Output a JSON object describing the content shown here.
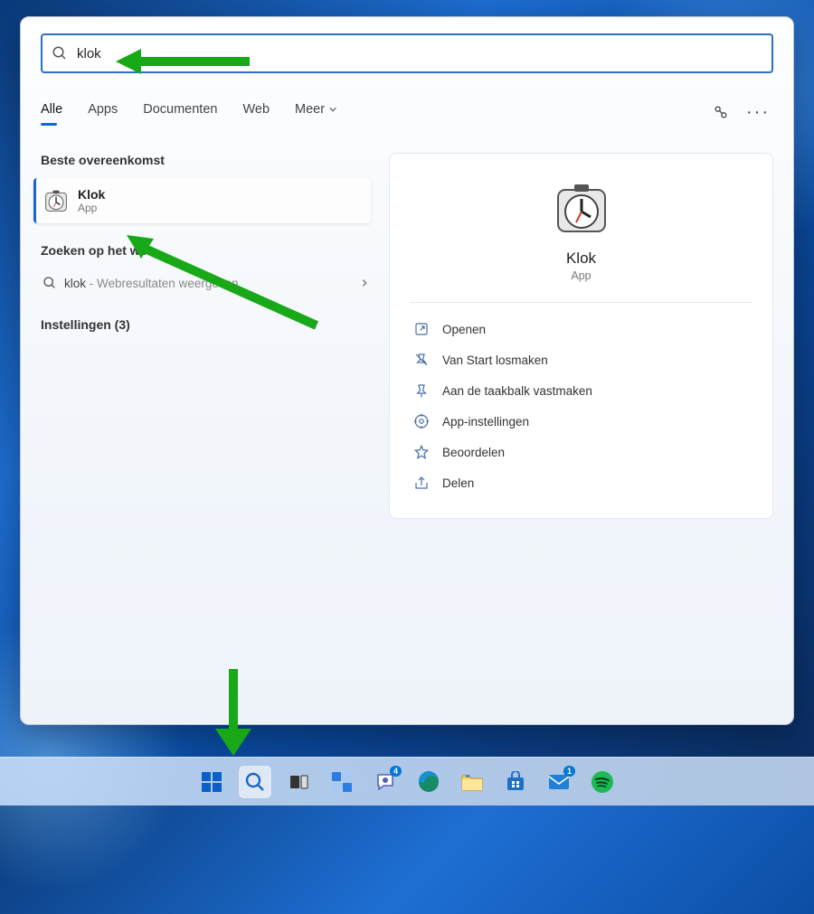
{
  "search": {
    "value": "klok"
  },
  "tabs": {
    "all": "Alle",
    "apps": "Apps",
    "docs": "Documenten",
    "web": "Web",
    "more": "Meer"
  },
  "sections": {
    "best_match": "Beste overeenkomst",
    "web_search": "Zoeken op het web",
    "settings": "Instellingen (3)"
  },
  "best_match": {
    "title": "Klok",
    "subtitle": "App"
  },
  "web_item": {
    "term": "klok",
    "hint": " - Webresultaten weergeven"
  },
  "preview": {
    "title": "Klok",
    "subtitle": "App",
    "actions": {
      "open": "Openen",
      "unpin_start": "Van Start losmaken",
      "pin_taskbar": "Aan de taakbalk vastmaken",
      "settings": "App-instellingen",
      "review": "Beoordelen",
      "share": "Delen"
    }
  },
  "taskbar": {
    "chat_badge": "4",
    "mail_badge": "1"
  }
}
